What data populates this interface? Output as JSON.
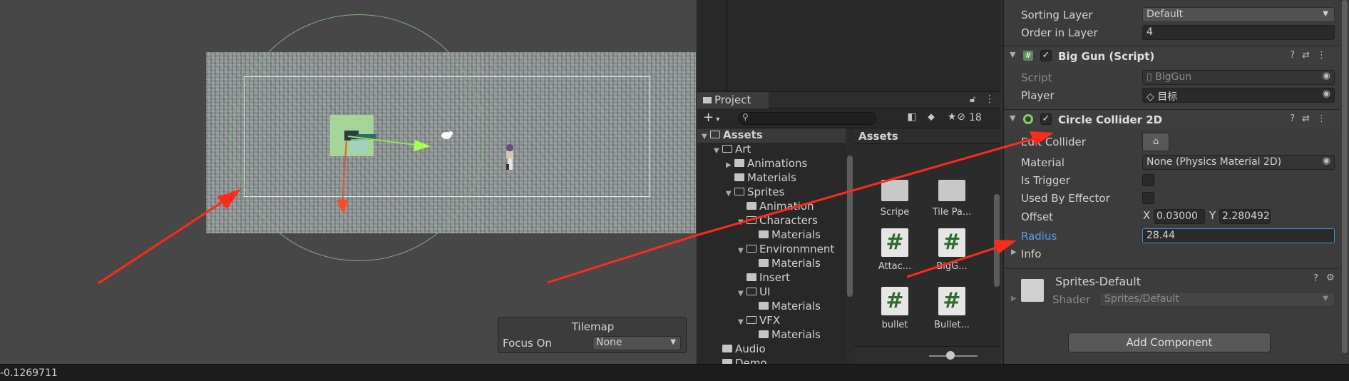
{
  "scene": {
    "tilemap_overlay": {
      "title": "Tilemap",
      "focus_label": "Focus On",
      "focus_value": "None"
    }
  },
  "project": {
    "tab_label": "Project",
    "hidden_count": "18",
    "tree": [
      {
        "label": "Assets",
        "depth": 0,
        "expanded": true,
        "selected": true
      },
      {
        "label": "Art",
        "depth": 1,
        "expanded": true
      },
      {
        "label": "Animations",
        "depth": 2,
        "expanded": false
      },
      {
        "label": "Materials",
        "depth": 2,
        "leaf": true
      },
      {
        "label": "Sprites",
        "depth": 2,
        "expanded": true
      },
      {
        "label": "Animation",
        "depth": 3,
        "leaf": true
      },
      {
        "label": "Characters",
        "depth": 3,
        "expanded": true
      },
      {
        "label": "Materials",
        "depth": 4,
        "leaf": true
      },
      {
        "label": "Environmnent",
        "depth": 3,
        "expanded": true
      },
      {
        "label": "Materials",
        "depth": 4,
        "leaf": true
      },
      {
        "label": "Insert",
        "depth": 3,
        "leaf": true
      },
      {
        "label": "UI",
        "depth": 3,
        "expanded": true
      },
      {
        "label": "Materials",
        "depth": 4,
        "leaf": true
      },
      {
        "label": "VFX",
        "depth": 3,
        "expanded": true
      },
      {
        "label": "Materials",
        "depth": 4,
        "leaf": true
      },
      {
        "label": "Audio",
        "depth": 1,
        "leaf": true
      },
      {
        "label": "Demo",
        "depth": 1,
        "leaf": true
      }
    ],
    "assets_header": "Assets",
    "assets": [
      {
        "label": "Scripe",
        "kind": "folder"
      },
      {
        "label": "Tile Pa...",
        "kind": "folder"
      },
      {
        "label": "Attac...",
        "kind": "script"
      },
      {
        "label": "BigG...",
        "kind": "script"
      },
      {
        "label": "bullet",
        "kind": "script"
      },
      {
        "label": "Bullet...",
        "kind": "script"
      }
    ]
  },
  "inspector": {
    "sorting_layer_label": "Sorting Layer",
    "sorting_layer_value": "Default",
    "order_label": "Order in Layer",
    "order_value": "4",
    "big_gun": {
      "title": "Big Gun (Script)",
      "script_label": "Script",
      "script_value": "BigGun",
      "player_label": "Player",
      "player_value": "目标"
    },
    "circle_collider": {
      "title": "Circle Collider 2D",
      "edit_collider_label": "Edit Collider",
      "material_label": "Material",
      "material_value": "None (Physics Material 2D)",
      "is_trigger_label": "Is Trigger",
      "used_by_effector_label": "Used By Effector",
      "offset_label": "Offset",
      "offset_x_label": "X",
      "offset_x": "0.03000",
      "offset_y_label": "Y",
      "offset_y": "2.280492",
      "radius_label": "Radius",
      "radius_value": "28.44",
      "info_label": "Info"
    },
    "material": {
      "name": "Sprites-Default",
      "shader_label": "Shader",
      "shader_value": "Sprites/Default"
    },
    "add_component": "Add Component"
  },
  "status": {
    "text": "-0.1269711"
  },
  "colors": {
    "annotation_arrow": "#ff2a1a",
    "collider_outline": "#7bb27b",
    "radius_highlight": "#3f8fd6"
  }
}
